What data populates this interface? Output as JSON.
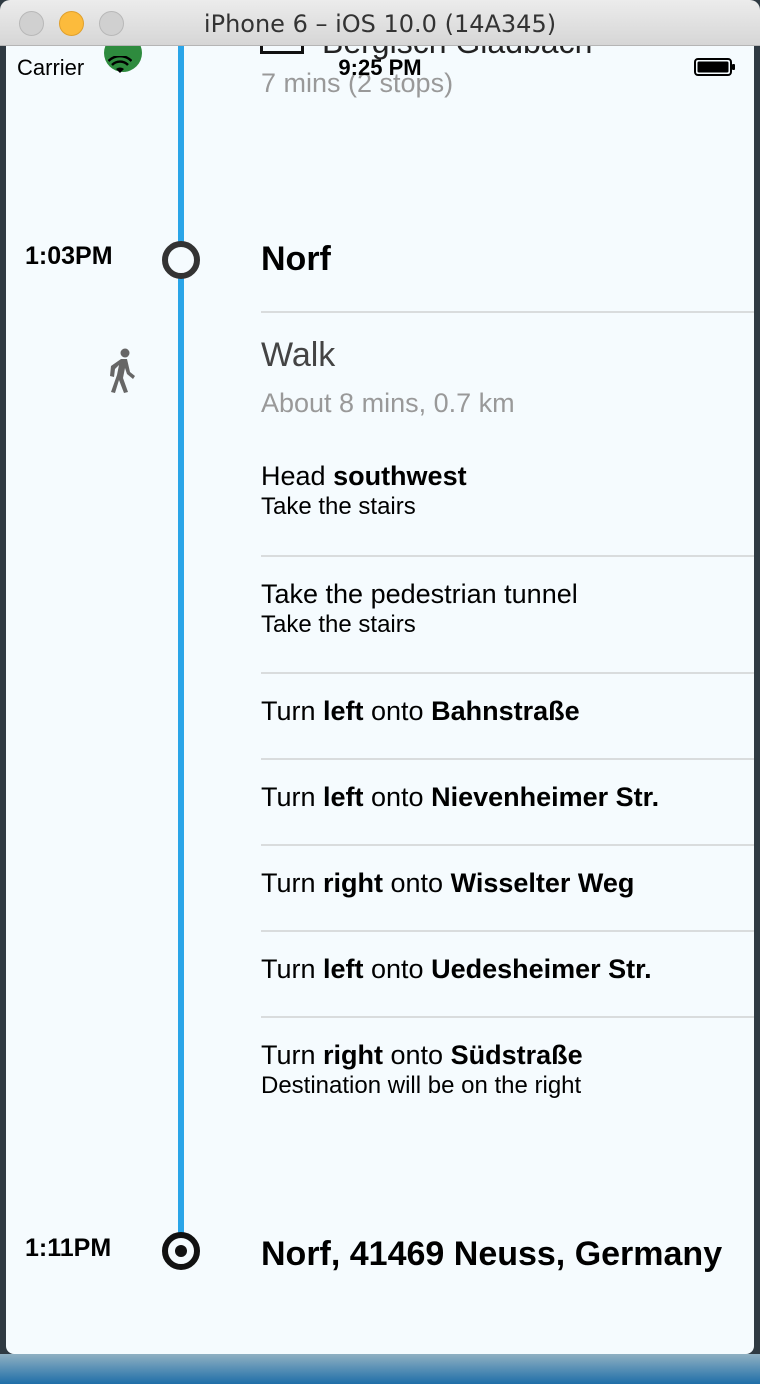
{
  "window": {
    "title": "iPhone 6 – iOS 10.0 (14A345)"
  },
  "status_bar": {
    "carrier": "Carrier",
    "time": "9:25 PM"
  },
  "previous_leg": {
    "title": "Bergisch Gladbach",
    "subtitle": "7 mins (2 stops)"
  },
  "stop": {
    "time": "1:03PM",
    "name": "Norf"
  },
  "walk": {
    "title": "Walk",
    "subtitle": "About 8 mins, 0.7 km"
  },
  "steps": [
    {
      "prefix": "Head ",
      "bold1": "southwest",
      "middle": "",
      "bold2": "",
      "sub": "Take the stairs"
    },
    {
      "prefix": "Take the pedestrian tunnel",
      "bold1": "",
      "middle": "",
      "bold2": "",
      "sub": "Take the stairs"
    },
    {
      "prefix": "Turn ",
      "bold1": "left",
      "middle": " onto ",
      "bold2": "Bahnstraße",
      "sub": ""
    },
    {
      "prefix": "Turn ",
      "bold1": "left",
      "middle": " onto ",
      "bold2": "Nievenheimer Str.",
      "sub": ""
    },
    {
      "prefix": "Turn ",
      "bold1": "right",
      "middle": " onto ",
      "bold2": "Wisselter Weg",
      "sub": ""
    },
    {
      "prefix": "Turn ",
      "bold1": "left",
      "middle": " onto ",
      "bold2": "Uedesheimer Str.",
      "sub": ""
    },
    {
      "prefix": "Turn ",
      "bold1": "right",
      "middle": " onto ",
      "bold2": "Südstraße",
      "sub": "Destination will be on the right"
    }
  ],
  "destination": {
    "time": "1:11PM",
    "name": "Norf, 41469 Neuss, Germany"
  },
  "colors": {
    "timeline": "#2aa5e8",
    "background": "#f5fbfe",
    "badge": "#2e8b3e"
  },
  "icons": {
    "walk": "walking-person-icon",
    "wifi": "wifi-icon",
    "battery": "battery-icon",
    "train": "s-bahn-badge-icon",
    "stop": "stop-circle-icon",
    "destination": "destination-circle-icon"
  }
}
